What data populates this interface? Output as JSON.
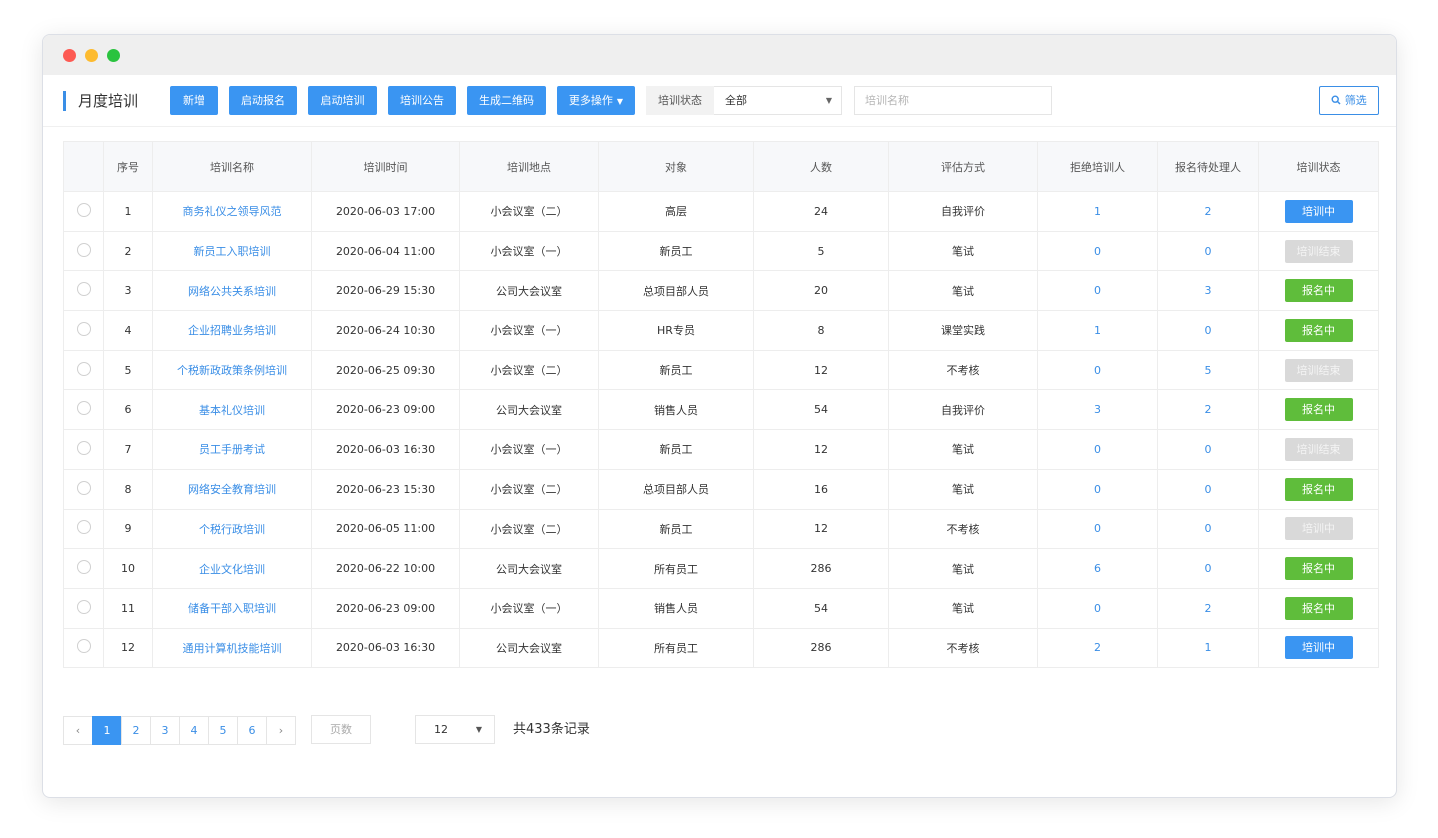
{
  "title": "月度培训",
  "toolbar": {
    "buttons": [
      {
        "label": "新增"
      },
      {
        "label": "启动报名"
      },
      {
        "label": "启动培训"
      },
      {
        "label": "培训公告"
      },
      {
        "label": "生成二维码"
      },
      {
        "label": "更多操作",
        "caret": "▼"
      }
    ],
    "filter_label": "培训状态",
    "filter_value": "全部",
    "filter_chevron": "▼",
    "name_placeholder": "培训名称",
    "filter_button": "筛选"
  },
  "table": {
    "headers": [
      "",
      "序号",
      "培训名称",
      "培训时间",
      "培训地点",
      "对象",
      "人数",
      "评估方式",
      "拒绝培训人",
      "报名待处理人",
      "培训状态"
    ],
    "rows": [
      {
        "no": "1",
        "name": "商务礼仪之领导风范",
        "time": "2020-06-03 17:00",
        "place": "小会议室（二）",
        "target": "高层",
        "count": "24",
        "eval": "自我评价",
        "reject": "1",
        "pending": "2",
        "status": "培训中",
        "status_color": "blue"
      },
      {
        "no": "2",
        "name": "新员工入职培训",
        "time": "2020-06-04 11:00",
        "place": "小会议室（一）",
        "target": "新员工",
        "count": "5",
        "eval": "笔试",
        "reject": "0",
        "pending": "0",
        "status": "培训结束",
        "status_color": "gray"
      },
      {
        "no": "3",
        "name": "网络公共关系培训",
        "time": "2020-06-29 15:30",
        "place": "公司大会议室",
        "target": "总项目部人员",
        "count": "20",
        "eval": "笔试",
        "reject": "0",
        "pending": "3",
        "status": "报名中",
        "status_color": "green"
      },
      {
        "no": "4",
        "name": "企业招聘业务培训",
        "time": "2020-06-24 10:30",
        "place": "小会议室（一）",
        "target": "HR专员",
        "count": "8",
        "eval": "课堂实践",
        "reject": "1",
        "pending": "0",
        "status": "报名中",
        "status_color": "green"
      },
      {
        "no": "5",
        "name": "个税新政政策条例培训",
        "time": "2020-06-25 09:30",
        "place": "小会议室（二）",
        "target": "新员工",
        "count": "12",
        "eval": "不考核",
        "reject": "0",
        "pending": "5",
        "status": "培训结束",
        "status_color": "gray"
      },
      {
        "no": "6",
        "name": "基本礼仪培训",
        "time": "2020-06-23 09:00",
        "place": "公司大会议室",
        "target": "销售人员",
        "count": "54",
        "eval": "自我评价",
        "reject": "3",
        "pending": "2",
        "status": "报名中",
        "status_color": "green"
      },
      {
        "no": "7",
        "name": "员工手册考试",
        "time": "2020-06-03 16:30",
        "place": "小会议室（一）",
        "target": "新员工",
        "count": "12",
        "eval": "笔试",
        "reject": "0",
        "pending": "0",
        "status": "培训结束",
        "status_color": "gray"
      },
      {
        "no": "8",
        "name": "网络安全教育培训",
        "time": "2020-06-23 15:30",
        "place": "小会议室（二）",
        "target": "总项目部人员",
        "count": "16",
        "eval": "笔试",
        "reject": "0",
        "pending": "0",
        "status": "报名中",
        "status_color": "green"
      },
      {
        "no": "9",
        "name": "个税行政培训",
        "time": "2020-06-05 11:00",
        "place": "小会议室（二）",
        "target": "新员工",
        "count": "12",
        "eval": "不考核",
        "reject": "0",
        "pending": "0",
        "status": "培训中",
        "status_color": "gray"
      },
      {
        "no": "10",
        "name": "企业文化培训",
        "time": "2020-06-22 10:00",
        "place": "公司大会议室",
        "target": "所有员工",
        "count": "286",
        "eval": "笔试",
        "reject": "6",
        "pending": "0",
        "status": "报名中",
        "status_color": "green"
      },
      {
        "no": "11",
        "name": "储备干部入职培训",
        "time": "2020-06-23 09:00",
        "place": "小会议室（一）",
        "target": "销售人员",
        "count": "54",
        "eval": "笔试",
        "reject": "0",
        "pending": "2",
        "status": "报名中",
        "status_color": "green"
      },
      {
        "no": "12",
        "name": "通用计算机技能培训",
        "time": "2020-06-03 16:30",
        "place": "公司大会议室",
        "target": "所有员工",
        "count": "286",
        "eval": "不考核",
        "reject": "2",
        "pending": "1",
        "status": "培训中",
        "status_color": "blue"
      }
    ]
  },
  "pagination": {
    "prev": "‹",
    "next": "›",
    "pages": [
      "1",
      "2",
      "3",
      "4",
      "5",
      "6"
    ],
    "current_page": "1",
    "jump_placeholder": "页数",
    "page_size": "12",
    "page_size_chevron": "▼",
    "total": "共433条记录"
  },
  "colors": {
    "accent": "#3a95f2",
    "green": "#5fbd3b",
    "gray": "#d9d9d9",
    "red_dot": "#fd5a53",
    "yellow_dot": "#fdbb2f",
    "green_dot": "#2ac33f"
  }
}
